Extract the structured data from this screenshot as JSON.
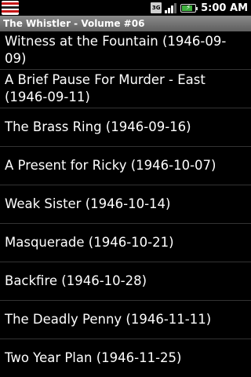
{
  "status_bar": {
    "network": "3G",
    "icons": [
      "notification-app-icon",
      "3g-icon",
      "signal-icon",
      "battery-charging-icon"
    ],
    "time": "5:00 AM",
    "signal_level": 0.6,
    "battery_level": 0.8
  },
  "title_bar": {
    "title": "The Whistler - Volume #06"
  },
  "episodes": [
    {
      "title": "Witness at the Fountain (1946-09-09)"
    },
    {
      "title": "A Brief Pause For Murder - East (1946-09-11)"
    },
    {
      "title": "The Brass Ring (1946-09-16)"
    },
    {
      "title": "A Present for Ricky (1946-10-07)"
    },
    {
      "title": "Weak Sister (1946-10-14)"
    },
    {
      "title": "Masquerade (1946-10-21)"
    },
    {
      "title": "Backfire (1946-10-28)"
    },
    {
      "title": "The Deadly Penny (1946-11-11)"
    },
    {
      "title": "Two Year Plan (1946-11-25)"
    }
  ],
  "colors": {
    "background": "#000000",
    "title_bar": "#6e6e6e",
    "divider": "#333333",
    "text": "#ffffff"
  }
}
